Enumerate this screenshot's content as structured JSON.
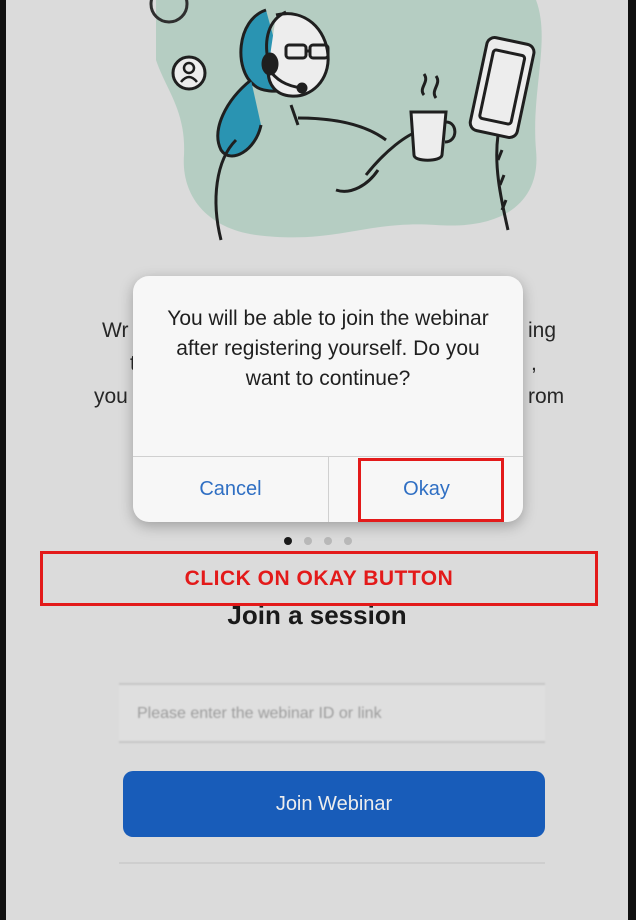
{
  "background_text": {
    "line1_left": "Wr",
    "line1_right": "ing",
    "line2_left": "t",
    "line2_right": ",",
    "line3_left": "you",
    "line3_right": "rom"
  },
  "dialog": {
    "message": "You will be able to join the webinar after registering yourself. Do you want to continue?",
    "cancel_label": "Cancel",
    "okay_label": "Okay"
  },
  "annotation": {
    "instruction": "CLICK ON OKAY BUTTON"
  },
  "session": {
    "title": "Join a session",
    "id_placeholder": "Please enter the webinar ID or link",
    "join_label": "Join Webinar"
  },
  "pagination": {
    "active_index": 0,
    "count": 4
  },
  "colors": {
    "accent_blue": "#1a63c7",
    "dialog_button_text": "#2f6fc3",
    "annotation_red": "#e31a1a",
    "illustration_teal": "#2ea0c0",
    "illustration_mint": "#b6d8c8"
  },
  "icons": {
    "user": "user-circle-icon"
  }
}
